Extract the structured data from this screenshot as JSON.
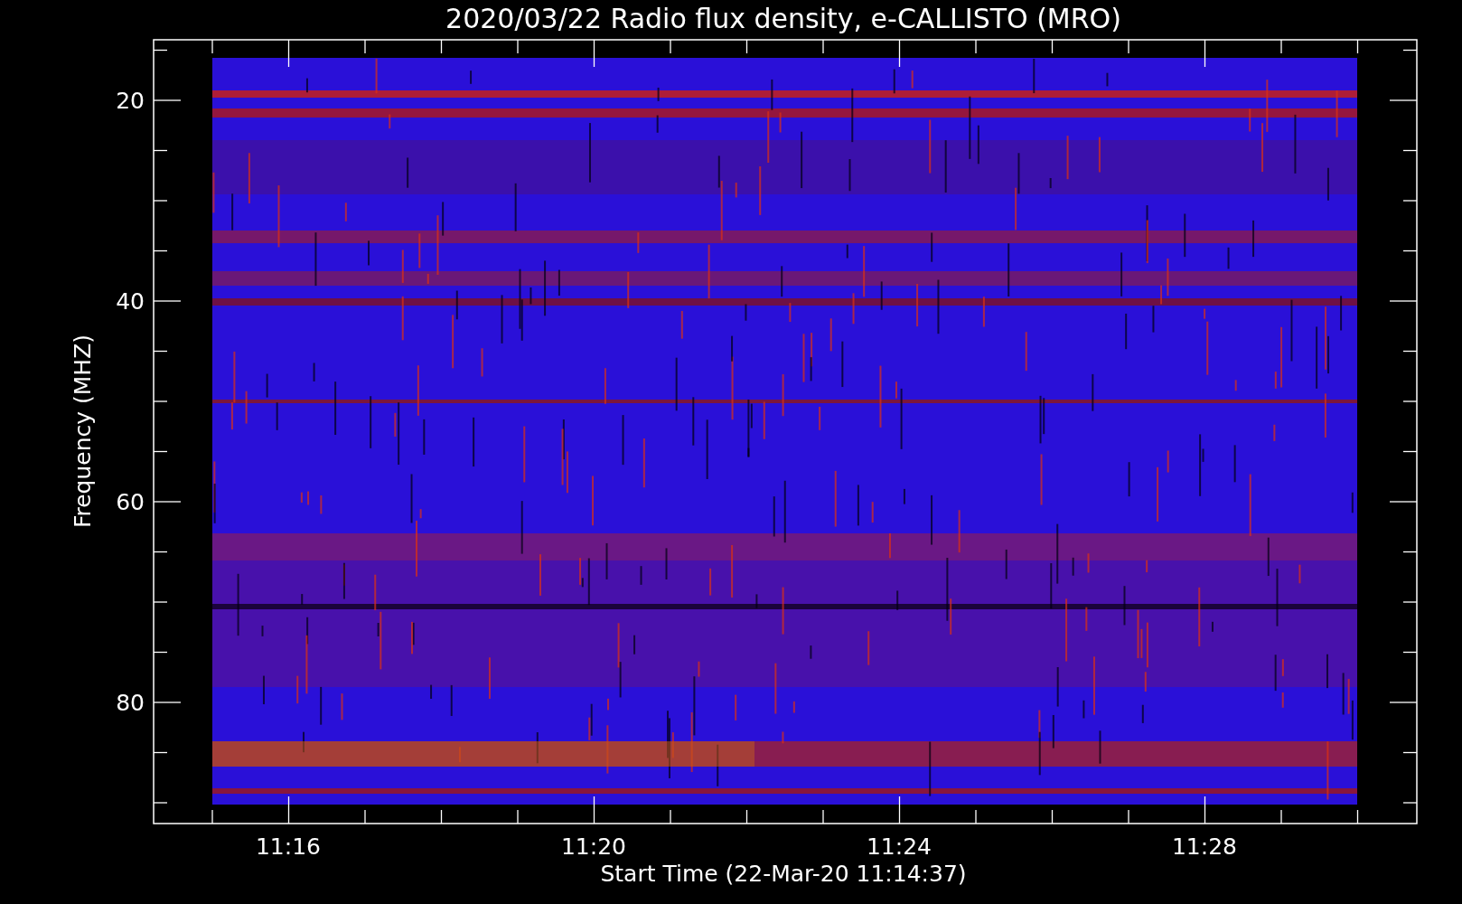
{
  "title": "2020/03/22  Radio flux density, e-CALLISTO (MRO)",
  "y_axis": {
    "label": "Frequency (MHZ)",
    "ticks": [
      "20",
      "40",
      "60",
      "80"
    ]
  },
  "x_axis": {
    "label": "Start Time (22-Mar-20 11:14:37)",
    "ticks": [
      "11:16",
      "11:20",
      "11:24",
      "11:28"
    ]
  }
}
